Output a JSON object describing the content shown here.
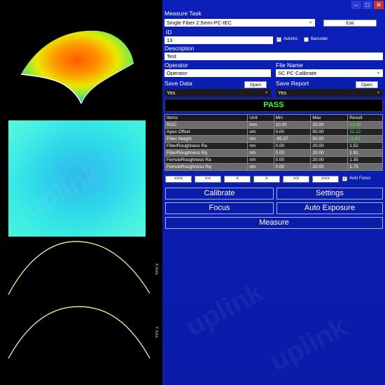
{
  "left": {
    "x_axis_label": "X Axis",
    "y_axis_label": "Y Axis",
    "watermark": "uplink"
  },
  "window": {
    "ctrl_min": "–",
    "ctrl_max": "□",
    "ctrl_close": "✕"
  },
  "measure_task": {
    "label": "Measure Task",
    "value": "Single Fiber 2.5mm-PC-IEC",
    "edit_label": "Edit"
  },
  "id": {
    "label": "ID",
    "value": "13",
    "autoinc_label": "AutoInc",
    "autoinc_checked": true,
    "barcoder_label": "Barcoder",
    "barcoder_checked": false
  },
  "description": {
    "label": "Description",
    "value": "Test"
  },
  "operator": {
    "label": "Operator",
    "value": "Operator"
  },
  "file_name": {
    "label": "File Name",
    "value": "SC PC Calibrate"
  },
  "save_data": {
    "label": "Save Data",
    "value": "Yes",
    "open_label": "Open"
  },
  "save_report": {
    "label": "Save Report",
    "value": "Yes",
    "open_label": "Open"
  },
  "result": {
    "status": "PASS",
    "status_color": "#3cff3c"
  },
  "table": {
    "headers": [
      "Items",
      "Unit",
      "Min",
      "Max",
      "Result"
    ],
    "rows": [
      [
        "ROC",
        "mm",
        "10.00",
        "25.00",
        "13.30"
      ],
      [
        "Apex Offset",
        "um",
        "0.00",
        "50.00",
        "22.12"
      ],
      [
        "Fiber Height",
        "nm",
        "-95.57",
        "50.00",
        "-3.53"
      ],
      [
        "FiberRoughness Ra",
        "nm",
        "0.00",
        "20.00",
        "1.52"
      ],
      [
        "FiberRoughness Rq",
        "nm",
        "0.00",
        "20.00",
        "1.91"
      ],
      [
        "FerruleRoughness Ra",
        "nm",
        "0.00",
        "20.00",
        "1.35"
      ],
      [
        "FerruleRoughness Rq",
        "nm",
        "0.00",
        "20.00",
        "1.75"
      ]
    ]
  },
  "nav": {
    "first": "<<<",
    "prev2": "<<",
    "prev": "<",
    "next": ">",
    "next2": ">>",
    "last": ">>>",
    "autofocus_label": "Auto Focus",
    "autofocus_checked": true
  },
  "buttons": {
    "calibrate": "Calibrate",
    "settings": "Settings",
    "focus": "Focus",
    "auto_exposure": "Auto Exposure",
    "measure": "Measure"
  }
}
